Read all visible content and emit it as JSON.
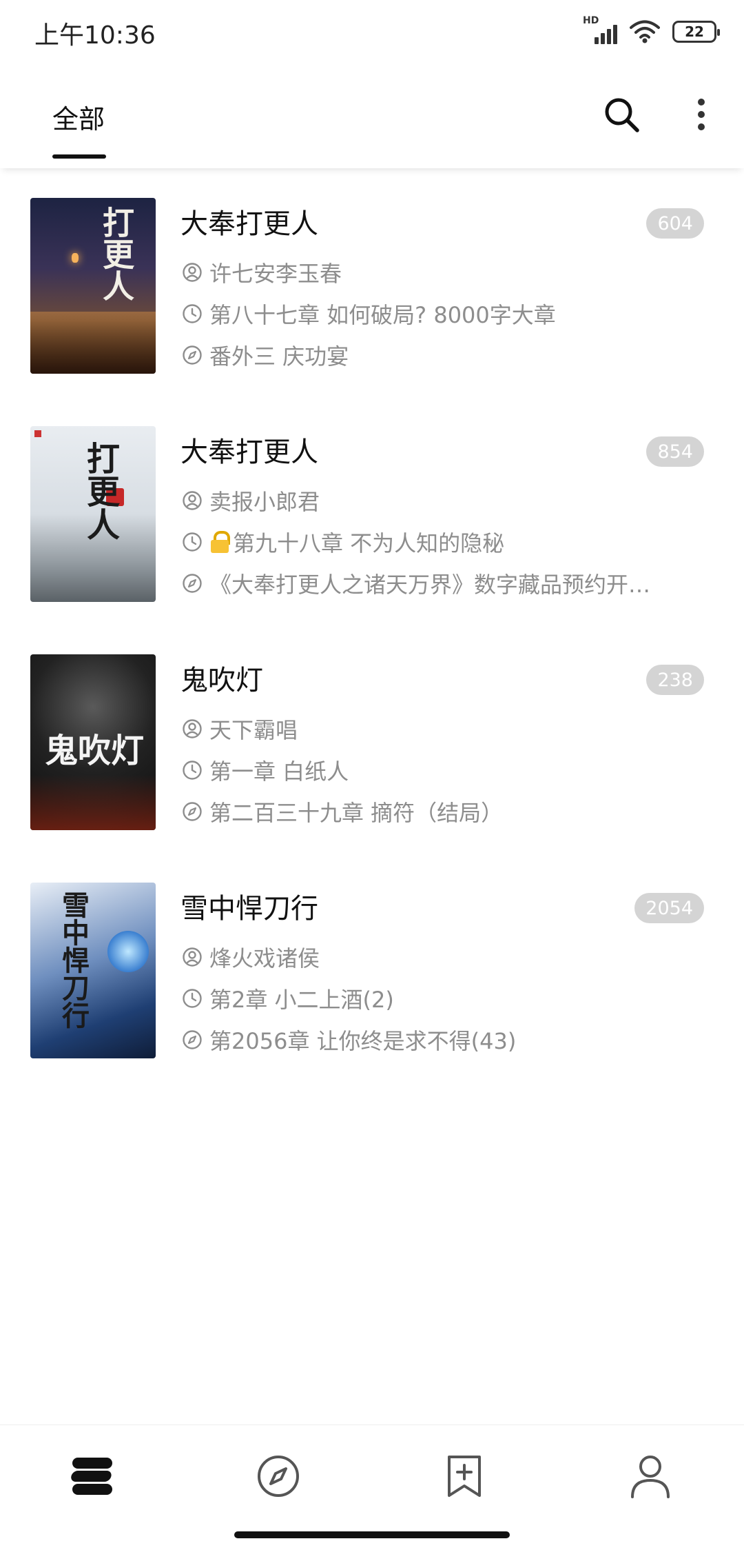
{
  "status_bar": {
    "time": "上午10:36",
    "network_label": "HD",
    "battery_level": "22"
  },
  "top_bar": {
    "tab_label": "全部",
    "search_icon": "search-icon",
    "more_icon": "more-vertical-icon"
  },
  "books": [
    {
      "title": "大奉打更人",
      "author": "许七安李玉春",
      "read_chapter": "第八十七章 如何破局? 8000字大章",
      "read_locked": false,
      "latest_chapter": "番外三 庆功宴",
      "unread_count": "604",
      "cover_text": "打更人"
    },
    {
      "title": "大奉打更人",
      "author": "卖报小郎君",
      "read_chapter": "第九十八章 不为人知的隐秘",
      "read_locked": true,
      "latest_chapter": "《大奉打更人之诸天万界》数字藏品预约开…",
      "unread_count": "854",
      "cover_text": "打更人"
    },
    {
      "title": "鬼吹灯",
      "author": "天下霸唱",
      "read_chapter": "第一章 白纸人",
      "read_locked": false,
      "latest_chapter": "第二百三十九章 摘符（结局）",
      "unread_count": "238",
      "cover_text": "鬼吹灯"
    },
    {
      "title": "雪中悍刀行",
      "author": "烽火戏诸侯",
      "read_chapter": "第2章 小二上酒(2)",
      "read_locked": false,
      "latest_chapter": "第2056章 让你终是求不得(43)",
      "unread_count": "2054",
      "cover_text": "雪中悍刀行"
    }
  ],
  "icons": {
    "author": "user-circle-icon",
    "read": "clock-icon",
    "latest": "compass-icon",
    "lock": "lock-icon"
  },
  "bottom_nav": [
    {
      "icon": "bookshelf-icon",
      "active": true
    },
    {
      "icon": "compass-icon",
      "active": false
    },
    {
      "icon": "bookmark-add-icon",
      "active": false
    },
    {
      "icon": "user-icon",
      "active": false
    }
  ],
  "colors": {
    "badge_bg": "#d4d4d4",
    "meta_text": "#8d8d8d",
    "primary_text": "#111111"
  }
}
